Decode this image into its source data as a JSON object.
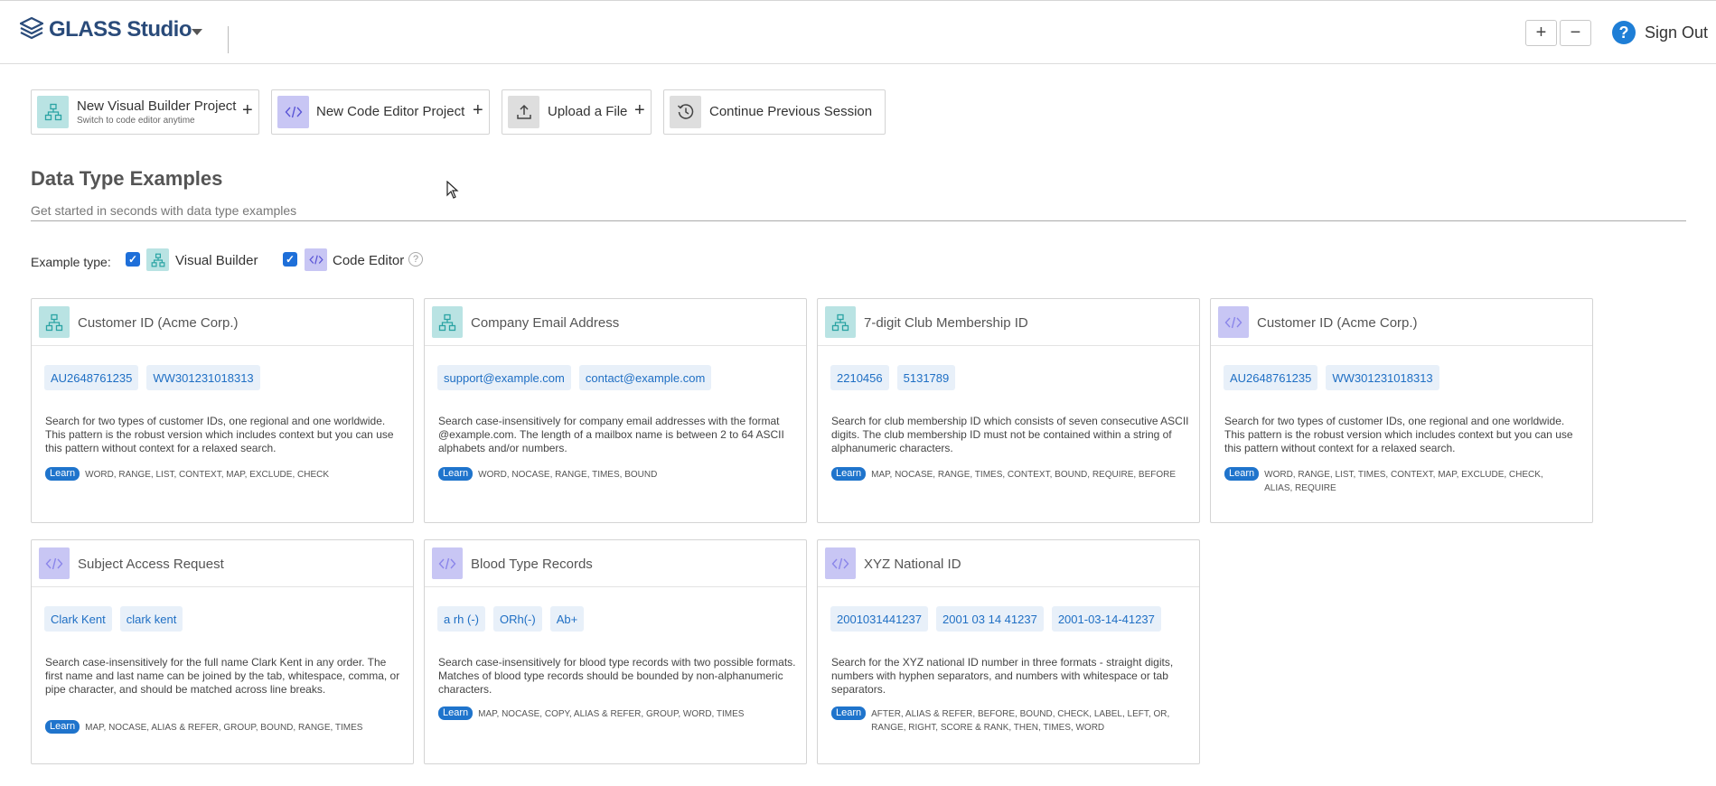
{
  "header": {
    "app_title": "GLASS Studio",
    "zoom_in": "+",
    "zoom_out": "−",
    "help": "?",
    "sign_out": "Sign Out"
  },
  "actions": [
    {
      "title": "New Visual Builder Project",
      "subtitle": "Switch to code editor anytime",
      "plus": "+",
      "icon": "visual-builder-icon"
    },
    {
      "title": "New Code Editor Project",
      "plus": "+",
      "icon": "code-editor-icon"
    },
    {
      "title": "Upload a File",
      "plus": "+",
      "icon": "upload-icon"
    },
    {
      "title": "Continue Previous Session",
      "icon": "history-icon"
    }
  ],
  "section": {
    "title": "Data Type Examples",
    "subtitle": "Get started in seconds with data type examples"
  },
  "filter": {
    "label": "Example type:",
    "visual_builder": "Visual Builder",
    "code_editor": "Code Editor",
    "help": "?"
  },
  "learn_label": "Learn",
  "cards": [
    {
      "kind": "visual",
      "title": "Customer ID (Acme Corp.)",
      "chips": [
        "AU2648761235",
        "WW301231018313"
      ],
      "description": "Search for two types of customer IDs, one regional and one worldwide. This pattern is the robust version which includes context but you can use this pattern without context for a relaxed search.",
      "tags": "WORD, RANGE, LIST, CONTEXT, MAP, EXCLUDE, CHECK"
    },
    {
      "kind": "visual",
      "title": "Company Email Address",
      "chips": [
        "support@example.com",
        "contact@example.com"
      ],
      "description": "Search case-insensitively for company email addresses with the format @example.com. The length of a mailbox name is between 2 to 64 ASCII alphabets and/or numbers.",
      "tags": "WORD, NOCASE, RANGE, TIMES, BOUND"
    },
    {
      "kind": "visual",
      "title": "7-digit Club Membership ID",
      "chips": [
        "2210456",
        "5131789"
      ],
      "description": "Search for club membership ID which consists of seven consecutive ASCII digits. The club membership ID must not be contained within a string of alphanumeric characters.",
      "tags": "MAP, NOCASE, RANGE, TIMES, CONTEXT, BOUND, REQUIRE, BEFORE"
    },
    {
      "kind": "code",
      "title": "Customer ID (Acme Corp.)",
      "chips": [
        "AU2648761235",
        "WW301231018313"
      ],
      "description": "Search for two types of customer IDs, one regional and one worldwide. This pattern is the robust version which includes context but you can use this pattern without context for a relaxed search.",
      "tags": "WORD, RANGE, LIST, TIMES, CONTEXT, MAP, EXCLUDE, CHECK, ALIAS, REQUIRE"
    },
    {
      "kind": "code",
      "title": "Subject Access Request",
      "chips": [
        "Clark Kent",
        "clark kent"
      ],
      "description": "Search case-insensitively for the full name Clark Kent in any order. The first name and last name can be joined by the tab, whitespace, comma, or pipe character, and should be matched across line breaks.",
      "tags": "MAP, NOCASE, ALIAS & REFER, GROUP, BOUND, RANGE, TIMES"
    },
    {
      "kind": "code",
      "title": "Blood Type Records",
      "chips": [
        "a rh (-)",
        "ORh(-)",
        "Ab+"
      ],
      "description": "Search case-insensitively for blood type records with two possible formats. Matches of blood type records should be bounded by non-alphanumeric characters.",
      "tags": "MAP, NOCASE, COPY, ALIAS & REFER, GROUP, WORD, TIMES"
    },
    {
      "kind": "code",
      "title": "XYZ National ID",
      "chips": [
        "2001031441237",
        "2001 03 14 41237",
        "2001-03-14-41237"
      ],
      "description": "Search for the XYZ national ID number in three formats - straight digits, numbers with hyphen separators, and numbers with whitespace or tab separators.",
      "tags": "AFTER, ALIAS & REFER, BEFORE, BOUND, CHECK, LABEL, LEFT, OR, RANGE, RIGHT, SCORE & RANK, THEN, TIMES, WORD"
    }
  ]
}
